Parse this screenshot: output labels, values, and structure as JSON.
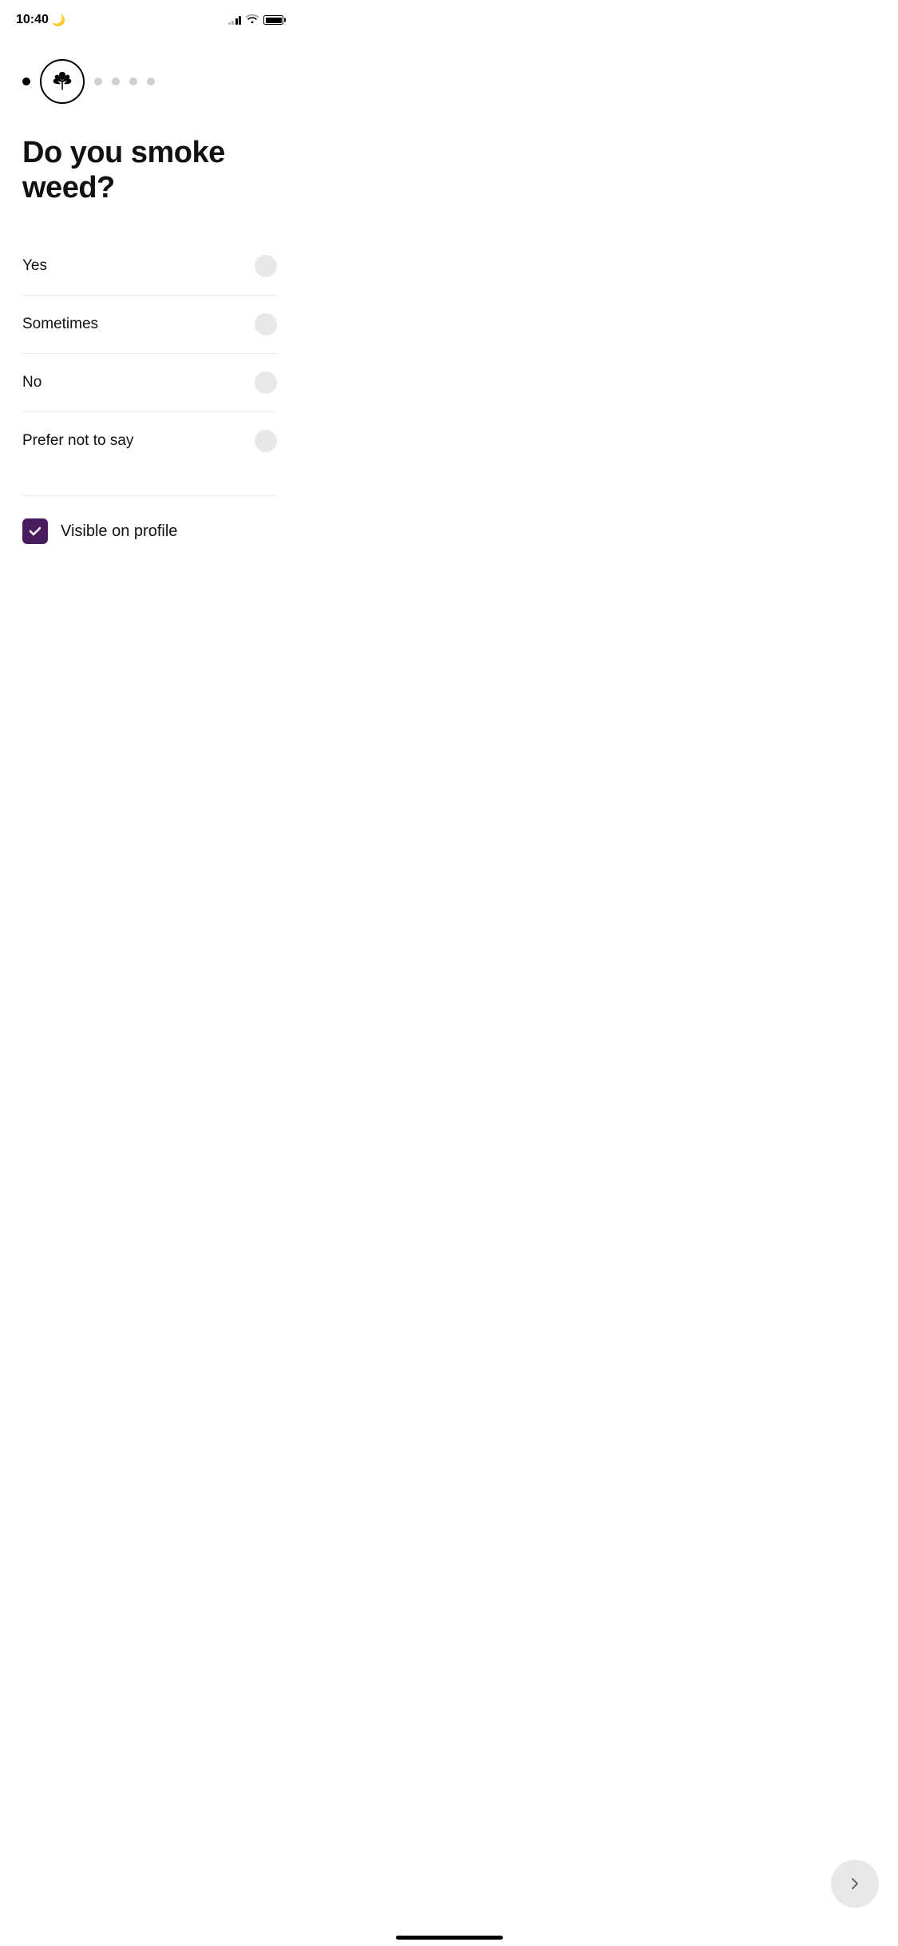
{
  "statusBar": {
    "time": "10:40",
    "moonIcon": "🌙"
  },
  "progress": {
    "dots": [
      {
        "id": 1,
        "active": true
      },
      {
        "id": 2,
        "active": false
      },
      {
        "id": 3,
        "active": false
      },
      {
        "id": 4,
        "active": false
      },
      {
        "id": 5,
        "active": false
      }
    ]
  },
  "question": {
    "title": "Do you smoke weed?"
  },
  "options": [
    {
      "id": "yes",
      "label": "Yes",
      "selected": false
    },
    {
      "id": "sometimes",
      "label": "Sometimes",
      "selected": false
    },
    {
      "id": "no",
      "label": "No",
      "selected": false
    },
    {
      "id": "prefer-not",
      "label": "Prefer not to say",
      "selected": false
    }
  ],
  "visibleOnProfile": {
    "label": "Visible on profile",
    "checked": true
  },
  "nextButton": {
    "ariaLabel": "Next"
  }
}
